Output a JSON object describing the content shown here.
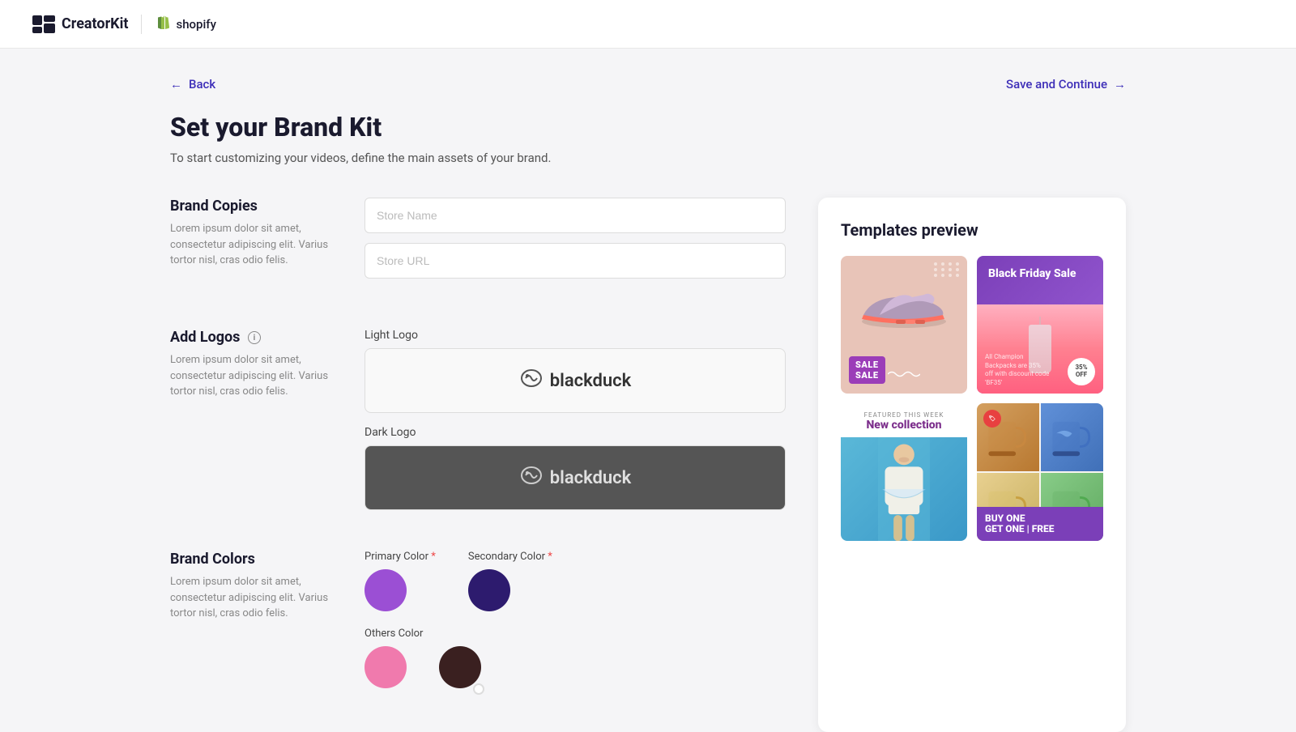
{
  "header": {
    "logo_text": "CreatorKit",
    "shopify_text": "shopify"
  },
  "nav": {
    "back_label": "Back",
    "save_continue_label": "Save and Continue"
  },
  "page": {
    "title": "Set your Brand Kit",
    "subtitle": "To start customizing your videos, define the main assets of your brand."
  },
  "brand_copies": {
    "title": "Brand Copies",
    "description": "Lorem ipsum dolor sit amet, consectetur adipiscing elit. Varius tortor nisl, cras odio felis.",
    "store_name_placeholder": "Store Name",
    "store_url_placeholder": "Store URL"
  },
  "add_logos": {
    "title": "Add Logos",
    "description": "Lorem ipsum dolor sit amet, consectetur adipiscing elit. Varius tortor nisl, cras odio felis.",
    "light_logo_label": "Light Logo",
    "dark_logo_label": "Dark Logo",
    "logo_display_text": "blackduck"
  },
  "brand_colors": {
    "title": "Brand Colors",
    "description": "Lorem ipsum dolor sit amet, consectetur adipiscing elit. Varius tortor nisl, cras odio felis.",
    "primary_label": "Primary Color",
    "secondary_label": "Secondary Color",
    "others_label": "Others Color",
    "primary_color": "#9b4fd4",
    "secondary_color": "#2d1b6e",
    "other_color_1": "#f07aad",
    "other_color_2": "#3a2020"
  },
  "templates_preview": {
    "title": "Templates preview",
    "template_1": {
      "badge": "SALE\nSALE"
    },
    "template_2": {
      "title": "Black Friday Sale",
      "caption": "All Champion Backpacks are 35% off with discount code 'BF35'"
    },
    "template_3": {
      "featured": "FEATURED THIS WEEK",
      "title": "New collection"
    },
    "template_4": {
      "line1": "BUY ONE",
      "line2": "GET ONE",
      "line3": "FREE"
    }
  }
}
